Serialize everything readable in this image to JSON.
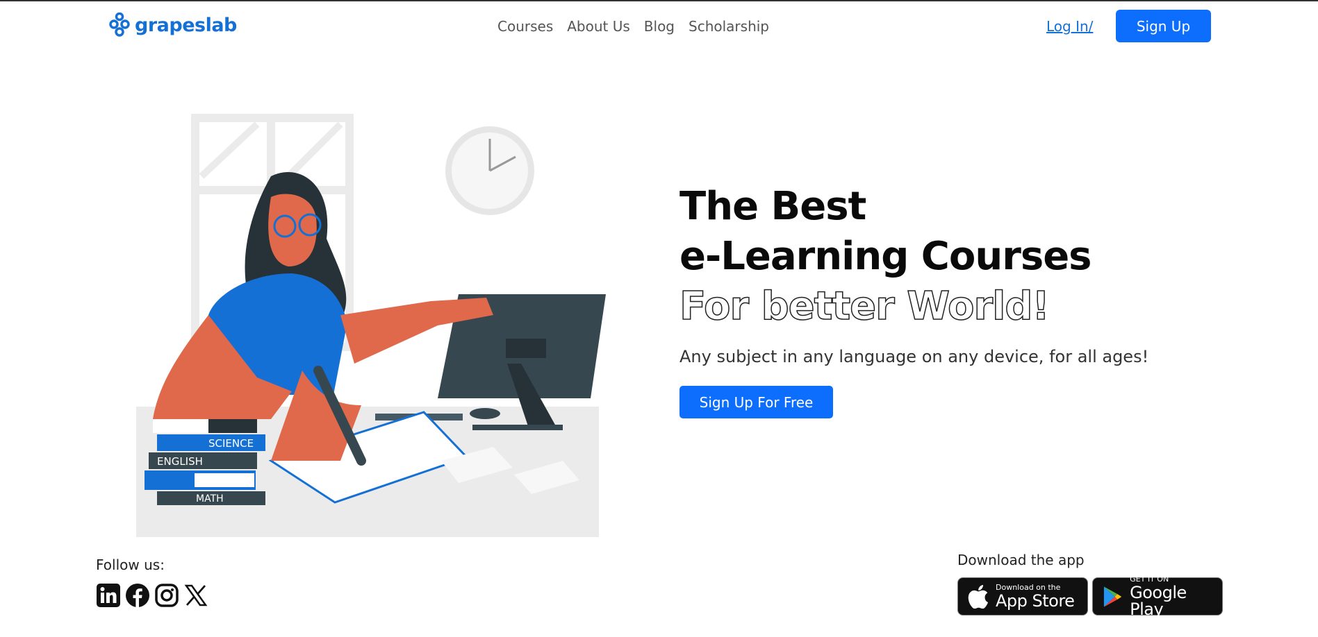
{
  "header": {
    "logo_text": "grapeslab",
    "nav": [
      "Courses",
      "About Us",
      "Blog",
      "Scholarship"
    ],
    "login_label": "Log In/",
    "signup_label": "Sign Up"
  },
  "hero": {
    "line1": "The Best",
    "line2": "e-Learning Courses",
    "line3": "For better World!",
    "subtitle": "Any subject in any language on any device, for all ages!",
    "cta_label": "Sign Up For Free"
  },
  "illustration": {
    "books": [
      "SCIENCE",
      "ENGLISH",
      "MATH"
    ]
  },
  "footer": {
    "follow_label": "Follow us:",
    "socials": [
      "linkedin-icon",
      "facebook-icon",
      "instagram-icon",
      "x-icon"
    ],
    "download_label": "Download the app",
    "app_store": {
      "small": "Download on the",
      "big": "App Store"
    },
    "google_play": {
      "small": "GET IT ON",
      "big": "Google Play"
    }
  },
  "colors": {
    "brand": "#1570d6",
    "button": "#0d6efd"
  }
}
